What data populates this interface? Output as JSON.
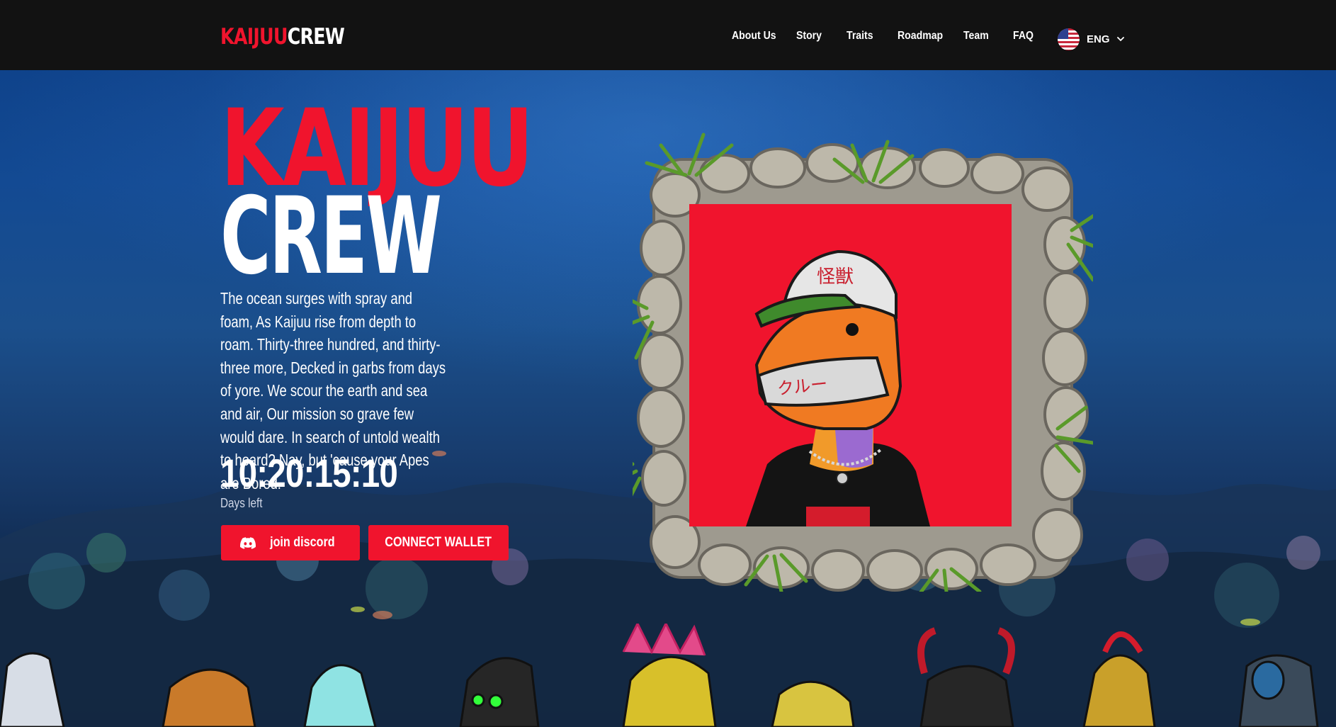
{
  "header": {
    "logo_red": "KAIJUU",
    "logo_white": "CREW",
    "nav": [
      "About Us",
      "Story",
      "Traits",
      "Roadmap",
      "Team",
      "FAQ"
    ],
    "language": "ENG",
    "language_icon": "us-flag-icon"
  },
  "hero": {
    "title_red": "KAIJUU",
    "title_white": "CREW",
    "poem": "The ocean surges with spray and foam, As Kaijuu rise from depth to roam. Thirty-three hundred, and thirty-three more, Decked in garbs from days of yore. We scour the earth and sea and air, Our mission so grave few would dare. In search of untold wealth to hoard? Nay, but 'cause your Apes are Bored.",
    "countdown": "10:20:15:10",
    "countdown_label": "Days left",
    "discord_label": "join discord",
    "discord_icon": "discord-icon",
    "wallet_label": "CONNECT WALLET"
  },
  "colors": {
    "brand_red": "#f0142d",
    "nav_bg": "#121212",
    "portrait_bg": "#f0142d"
  }
}
